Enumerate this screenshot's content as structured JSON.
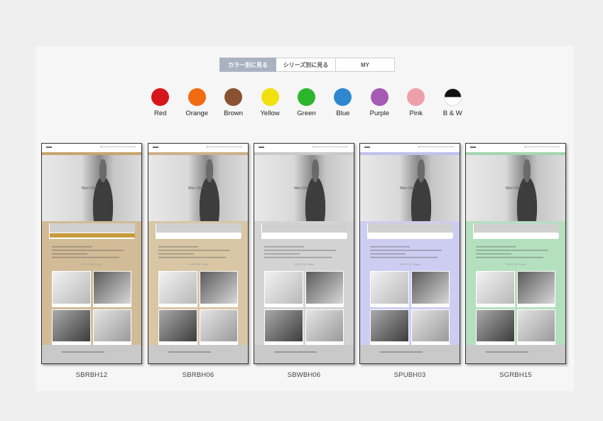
{
  "tabs": [
    {
      "label": "カラー別に見る",
      "active": true
    },
    {
      "label": "シリーズ別に見る",
      "active": false
    },
    {
      "label": "MY",
      "active": false
    }
  ],
  "colors": [
    {
      "label": "Red",
      "hex": "#d6161c"
    },
    {
      "label": "Orange",
      "hex": "#f26a12"
    },
    {
      "label": "Brown",
      "hex": "#8a5232"
    },
    {
      "label": "Yellow",
      "hex": "#f2e010"
    },
    {
      "label": "Green",
      "hex": "#2db52d"
    },
    {
      "label": "Blue",
      "hex": "#2f88cf"
    },
    {
      "label": "Purple",
      "hex": "#a55bb4"
    },
    {
      "label": "Pink",
      "hex": "#eea0aa"
    },
    {
      "label": "B & W",
      "hex": "#111111"
    }
  ],
  "templates": [
    {
      "code": "SBRBH12",
      "accent": "#d2bb97",
      "bar": "#c8a56e",
      "strip": "#c89a3c",
      "hero_caption": "Man Cloth"
    },
    {
      "code": "SBRBH06",
      "accent": "#d8c6a5",
      "bar": "#cdb08a",
      "strip": "#ffffff",
      "hero_caption": "Man Cloth"
    },
    {
      "code": "SBWBH06",
      "accent": "#d3d3d3",
      "bar": "#c9c9c9",
      "strip": "#ffffff",
      "hero_caption": "Man Cloth"
    },
    {
      "code": "SPUBH03",
      "accent": "#cdcdf2",
      "bar": "#c1c1ee",
      "strip": "#ffffff",
      "hero_caption": "Man Cloth"
    },
    {
      "code": "SGRBH15",
      "accent": "#b4e0bf",
      "bar": "#a3d6b0",
      "strip": "#ffffff",
      "hero_caption": "Man Cloth"
    }
  ],
  "thumb_trend": "2015 F/W Trend"
}
